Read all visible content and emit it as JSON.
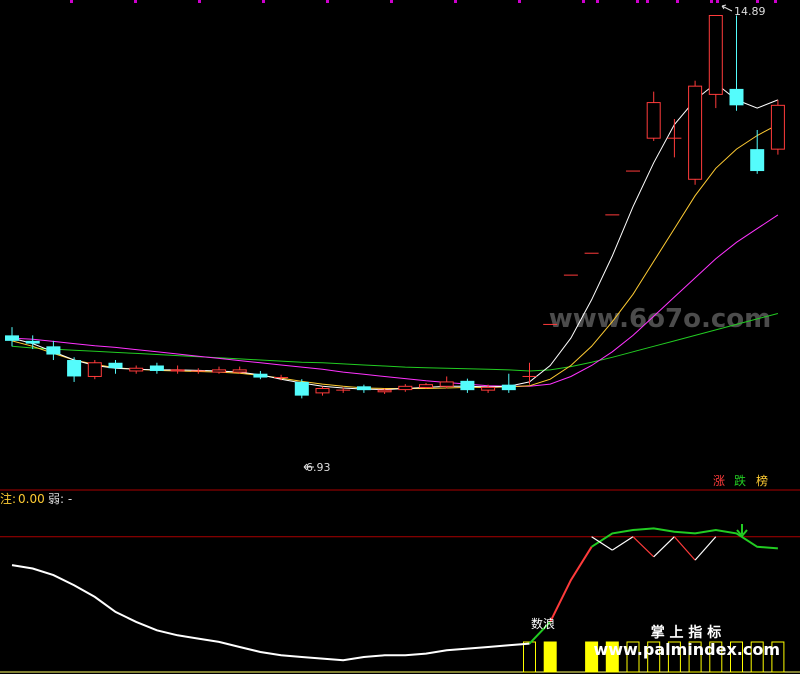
{
  "colors": {
    "background": "#000000",
    "up": "#ff3b3b",
    "down": "#54fcfc",
    "ma5": "#ffffff",
    "ma10": "#ffcc33",
    "ma20": "#ff33ff",
    "ma60": "#22cc22",
    "separator": "#aa0000",
    "volume_bar": "#ffff00",
    "grid_dot": "#cc00cc"
  },
  "annotations": {
    "high_label": "14.89",
    "low_label": "6.93"
  },
  "legend": {
    "up": "涨",
    "down": "跌",
    "limit": "榜"
  },
  "indicator": {
    "header_name": "注:",
    "header_value": "0.00",
    "header_weak": "弱: -",
    "wave_label": "数浪"
  },
  "watermarks": {
    "top": "www.6o7o.com",
    "bottom_title": "掌 上 指 标",
    "bottom_url": "www.palmindex.com"
  },
  "chart_data": [
    {
      "type": "candlestick",
      "ylim": [
        6.3,
        15.1
      ],
      "candles": [
        {
          "o": 9.05,
          "c": 8.95,
          "h": 9.2,
          "l": 8.85
        },
        {
          "o": 8.95,
          "c": 8.9,
          "h": 9.05,
          "l": 8.8
        },
        {
          "o": 8.85,
          "c": 8.7,
          "h": 8.95,
          "l": 8.6
        },
        {
          "o": 8.6,
          "c": 8.3,
          "h": 8.65,
          "l": 8.2
        },
        {
          "o": 8.3,
          "c": 8.55,
          "h": 8.6,
          "l": 8.25
        },
        {
          "o": 8.55,
          "c": 8.45,
          "h": 8.6,
          "l": 8.35
        },
        {
          "o": 8.4,
          "c": 8.45,
          "h": 8.5,
          "l": 8.35
        },
        {
          "o": 8.5,
          "c": 8.4,
          "h": 8.55,
          "l": 8.35
        },
        {
          "o": 8.4,
          "c": 8.42,
          "h": 8.5,
          "l": 8.35
        },
        {
          "o": 8.4,
          "c": 8.4,
          "h": 8.45,
          "l": 8.35
        },
        {
          "o": 8.38,
          "c": 8.42,
          "h": 8.48,
          "l": 8.35
        },
        {
          "o": 8.38,
          "c": 8.42,
          "h": 8.48,
          "l": 8.35
        },
        {
          "o": 8.35,
          "c": 8.28,
          "h": 8.4,
          "l": 8.25
        },
        {
          "o": 8.28,
          "c": 8.28,
          "h": 8.33,
          "l": 8.23
        },
        {
          "o": 8.2,
          "c": 7.95,
          "h": 8.25,
          "l": 7.9
        },
        {
          "o": 8.0,
          "c": 8.08,
          "h": 8.12,
          "l": 7.95
        },
        {
          "o": 8.05,
          "c": 8.05,
          "h": 8.1,
          "l": 8.0
        },
        {
          "o": 8.12,
          "c": 8.05,
          "h": 8.15,
          "l": 8.0
        },
        {
          "o": 8.02,
          "c": 8.05,
          "h": 8.08,
          "l": 7.98
        },
        {
          "o": 8.06,
          "c": 8.12,
          "h": 8.16,
          "l": 8.02
        },
        {
          "o": 8.1,
          "c": 8.15,
          "h": 8.18,
          "l": 8.08
        },
        {
          "o": 8.12,
          "c": 8.2,
          "h": 8.3,
          "l": 8.08
        },
        {
          "o": 8.22,
          "c": 8.05,
          "h": 8.26,
          "l": 8.0
        },
        {
          "o": 8.05,
          "c": 8.1,
          "h": 8.15,
          "l": 8.0
        },
        {
          "o": 8.15,
          "c": 8.05,
          "h": 8.35,
          "l": 8.0
        },
        {
          "o": 8.3,
          "c": 8.3,
          "h": 8.55,
          "l": 8.15
        },
        {
          "o": 9.25,
          "c": 9.25,
          "h": 9.25,
          "l": 9.25
        },
        {
          "o": 10.15,
          "c": 10.15,
          "h": 10.15,
          "l": 10.15
        },
        {
          "o": 10.55,
          "c": 10.55,
          "h": 10.55,
          "l": 10.55
        },
        {
          "o": 11.25,
          "c": 11.25,
          "h": 11.25,
          "l": 11.25
        },
        {
          "o": 12.05,
          "c": 12.05,
          "h": 12.05,
          "l": 12.05
        },
        {
          "o": 12.65,
          "c": 13.3,
          "h": 13.5,
          "l": 12.6
        },
        {
          "o": 12.65,
          "c": 12.65,
          "h": 13.0,
          "l": 12.3
        },
        {
          "o": 11.9,
          "c": 13.6,
          "h": 13.7,
          "l": 11.8
        },
        {
          "o": 13.45,
          "c": 14.89,
          "h": 14.89,
          "l": 13.2
        },
        {
          "o": 13.55,
          "c": 13.25,
          "h": 14.89,
          "l": 13.15
        },
        {
          "o": 12.45,
          "c": 12.05,
          "h": 12.8,
          "l": 12.0
        },
        {
          "o": 12.45,
          "c": 13.25,
          "h": 13.35,
          "l": 12.35
        }
      ],
      "ma5": [
        9.0,
        8.9,
        8.75,
        8.6,
        8.5,
        8.45,
        8.43,
        8.42,
        8.42,
        8.41,
        8.4,
        8.38,
        8.33,
        8.25,
        8.18,
        8.12,
        8.09,
        8.07,
        8.06,
        8.08,
        8.1,
        8.12,
        8.12,
        8.11,
        8.12,
        8.2,
        8.5,
        9.0,
        9.7,
        10.5,
        11.4,
        12.2,
        12.9,
        13.35,
        13.65,
        13.35,
        13.2,
        13.35
      ],
      "ma10": [
        8.95,
        8.85,
        8.72,
        8.6,
        8.52,
        8.46,
        8.43,
        8.41,
        8.4,
        8.39,
        8.38,
        8.36,
        8.32,
        8.27,
        8.21,
        8.16,
        8.12,
        8.09,
        8.08,
        8.08,
        8.08,
        8.09,
        8.1,
        8.1,
        8.11,
        8.13,
        8.25,
        8.5,
        8.85,
        9.3,
        9.8,
        10.4,
        11.0,
        11.6,
        12.1,
        12.45,
        12.7,
        12.9
      ],
      "ma20": [
        9.0,
        8.98,
        8.94,
        8.9,
        8.86,
        8.83,
        8.79,
        8.75,
        8.71,
        8.67,
        8.63,
        8.59,
        8.55,
        8.51,
        8.47,
        8.43,
        8.38,
        8.34,
        8.3,
        8.26,
        8.22,
        8.19,
        8.16,
        8.13,
        8.12,
        8.12,
        8.16,
        8.3,
        8.5,
        8.75,
        9.05,
        9.4,
        9.75,
        10.1,
        10.45,
        10.75,
        11.0,
        11.25
      ],
      "ma60": [
        8.85,
        8.82,
        8.8,
        8.78,
        8.76,
        8.74,
        8.72,
        8.7,
        8.68,
        8.66,
        8.64,
        8.62,
        8.6,
        8.58,
        8.56,
        8.55,
        8.53,
        8.51,
        8.49,
        8.47,
        8.46,
        8.45,
        8.44,
        8.43,
        8.42,
        8.4,
        8.42,
        8.48,
        8.56,
        8.65,
        8.75,
        8.85,
        8.95,
        9.05,
        9.15,
        9.25,
        9.35,
        9.45
      ]
    },
    {
      "type": "line",
      "ylim": [
        0,
        100
      ],
      "reference_line": 81,
      "wave_line": [
        64,
        62,
        58,
        52,
        45,
        36,
        30,
        25,
        22,
        20,
        18,
        15,
        12,
        10,
        9,
        8,
        7,
        9,
        10,
        10,
        11,
        13,
        14,
        15,
        16,
        17,
        30,
        55,
        75,
        83,
        85,
        86,
        84,
        83,
        85,
        83,
        75,
        74
      ],
      "upper_zigzag": [
        null,
        null,
        null,
        null,
        null,
        null,
        null,
        null,
        null,
        null,
        null,
        null,
        null,
        null,
        null,
        null,
        null,
        null,
        null,
        null,
        null,
        null,
        null,
        null,
        null,
        null,
        null,
        null,
        81,
        73,
        81,
        69,
        81,
        67,
        81,
        null,
        null,
        null
      ],
      "bars": [
        0,
        0,
        0,
        0,
        0,
        0,
        0,
        0,
        0,
        0,
        0,
        0,
        0,
        0,
        0,
        0,
        0,
        0,
        0,
        0,
        0,
        0,
        0,
        0,
        0,
        1,
        2,
        0,
        2,
        2,
        1,
        1,
        1,
        1,
        1,
        1,
        1,
        1
      ]
    }
  ]
}
